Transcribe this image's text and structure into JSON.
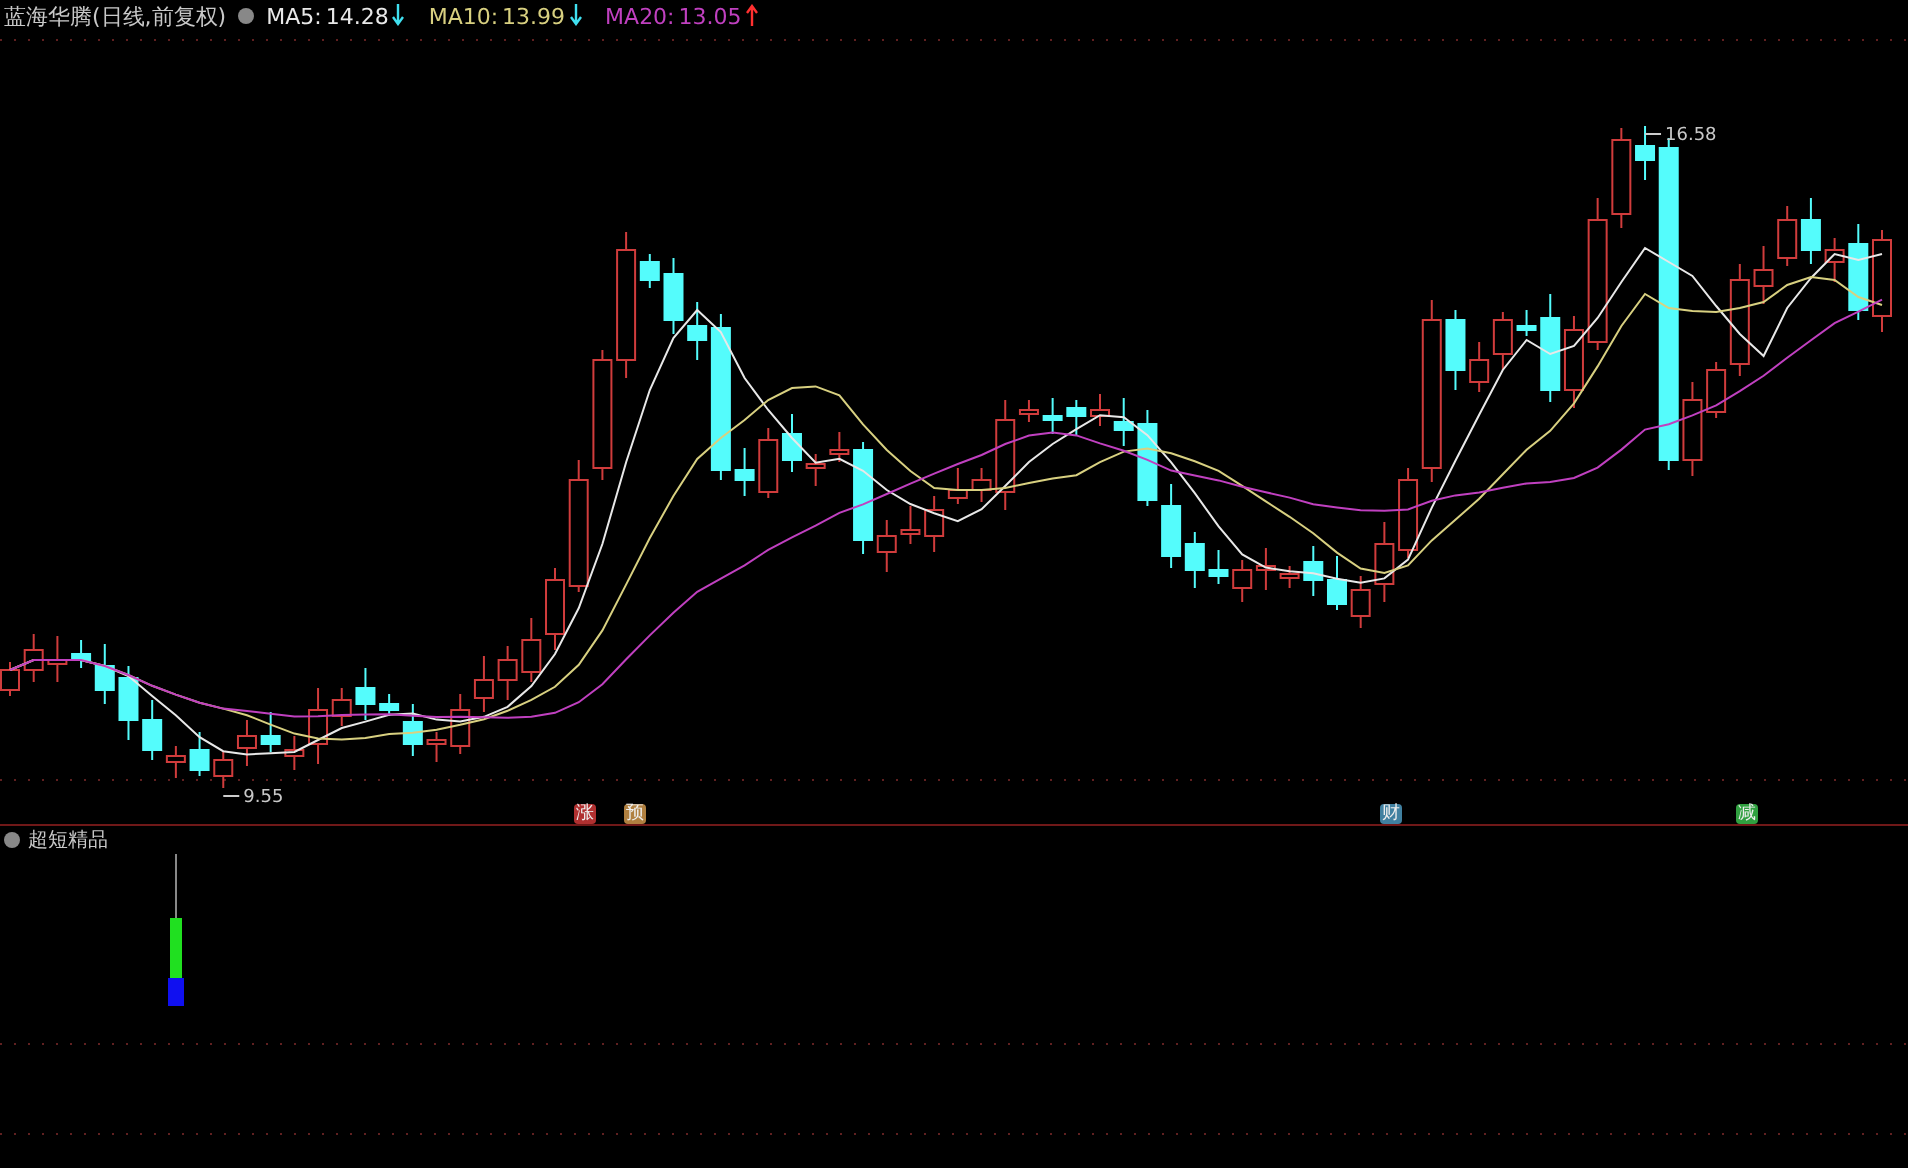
{
  "title": "蓝海华腾(日线,前复权)",
  "indicators": [
    {
      "name": "MA5:",
      "value": "14.28",
      "rising": false,
      "color": "#e8e8e8"
    },
    {
      "name": "MA10:",
      "value": "13.99",
      "rising": false,
      "color": "#d8d080"
    },
    {
      "name": "MA20:",
      "value": "13.05",
      "rising": true,
      "color": "#c040c0"
    }
  ],
  "price_labels": [
    {
      "text": "16.58",
      "kind": "high"
    },
    {
      "text": "9.55",
      "kind": "low"
    }
  ],
  "signal_markers": [
    {
      "text": "涨",
      "color": "#b03030"
    },
    {
      "text": "预",
      "color": "#b08040"
    },
    {
      "text": "财",
      "color": "#4080a0"
    },
    {
      "text": "减",
      "color": "#30a040"
    }
  ],
  "lower_panel": {
    "title": "超短精品"
  }
}
